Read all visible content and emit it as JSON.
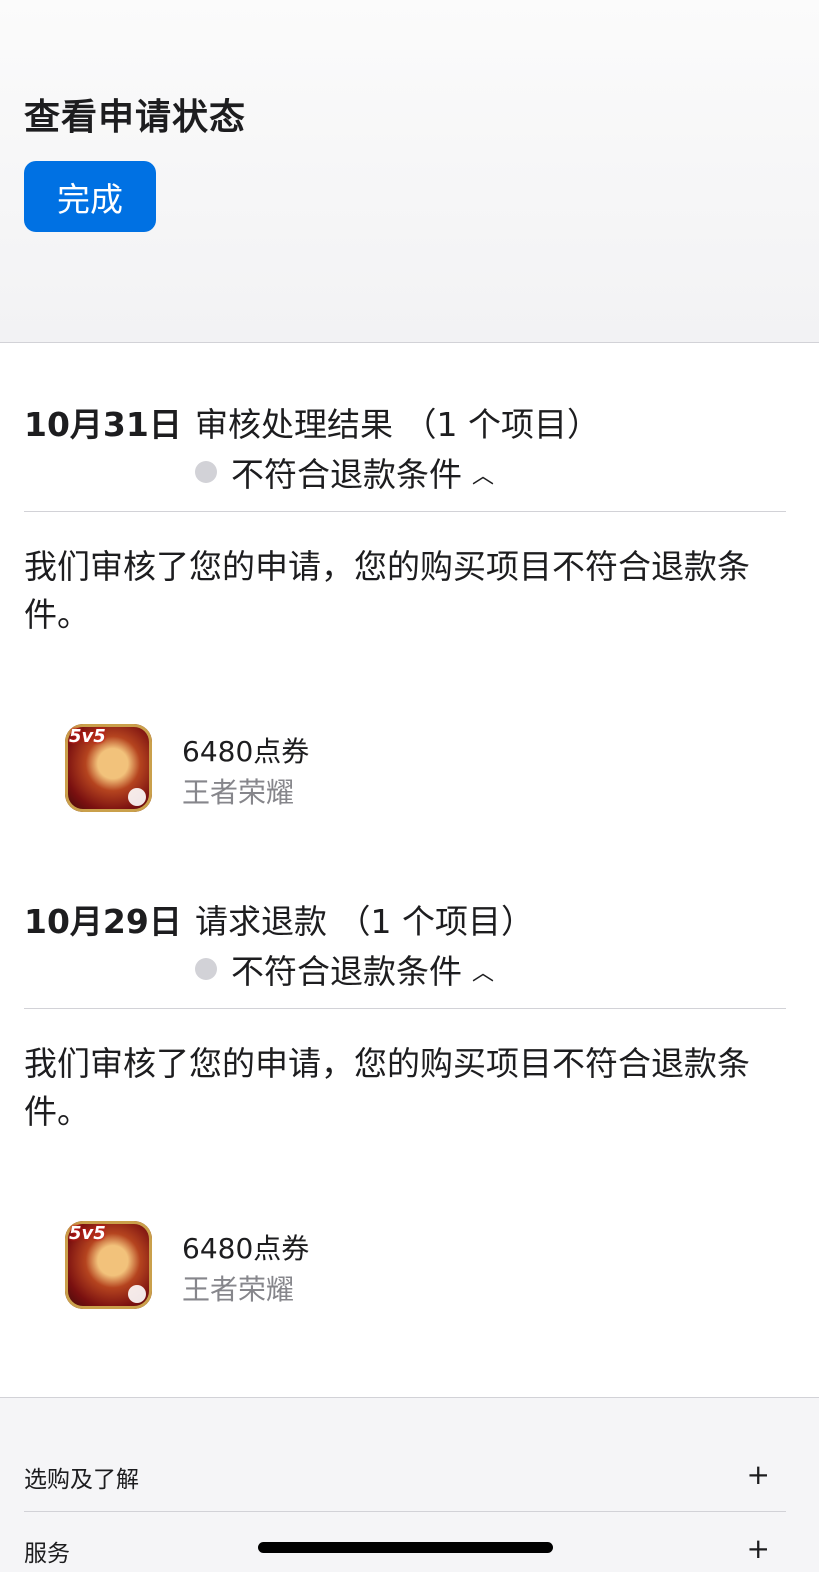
{
  "header": {
    "title": "查看申请状态",
    "done_label": "完成"
  },
  "entries": [
    {
      "date": "10月31日",
      "title": "审核处理结果 （1 个项目）",
      "status": "不符合退款条件",
      "message": "我们审核了您的申请，您的购买项目不符合退款条件。",
      "item": {
        "name": "6480点券",
        "app": "王者荣耀",
        "icon": "game-app-icon"
      }
    },
    {
      "date": "10月29日",
      "title": "请求退款 （1 个项目）",
      "status": "不符合退款条件",
      "message": "我们审核了您的申请，您的购买项目不符合退款条件。",
      "item": {
        "name": "6480点券",
        "app": "王者荣耀",
        "icon": "game-app-icon"
      }
    }
  ],
  "footer": {
    "rows": [
      {
        "label": "选购及了解",
        "toggle": "+"
      },
      {
        "label": "服务",
        "toggle": "+"
      }
    ]
  },
  "colors": {
    "accent": "#0071e3",
    "divider": "#d2d2d7",
    "secondary_text": "#86868b"
  }
}
